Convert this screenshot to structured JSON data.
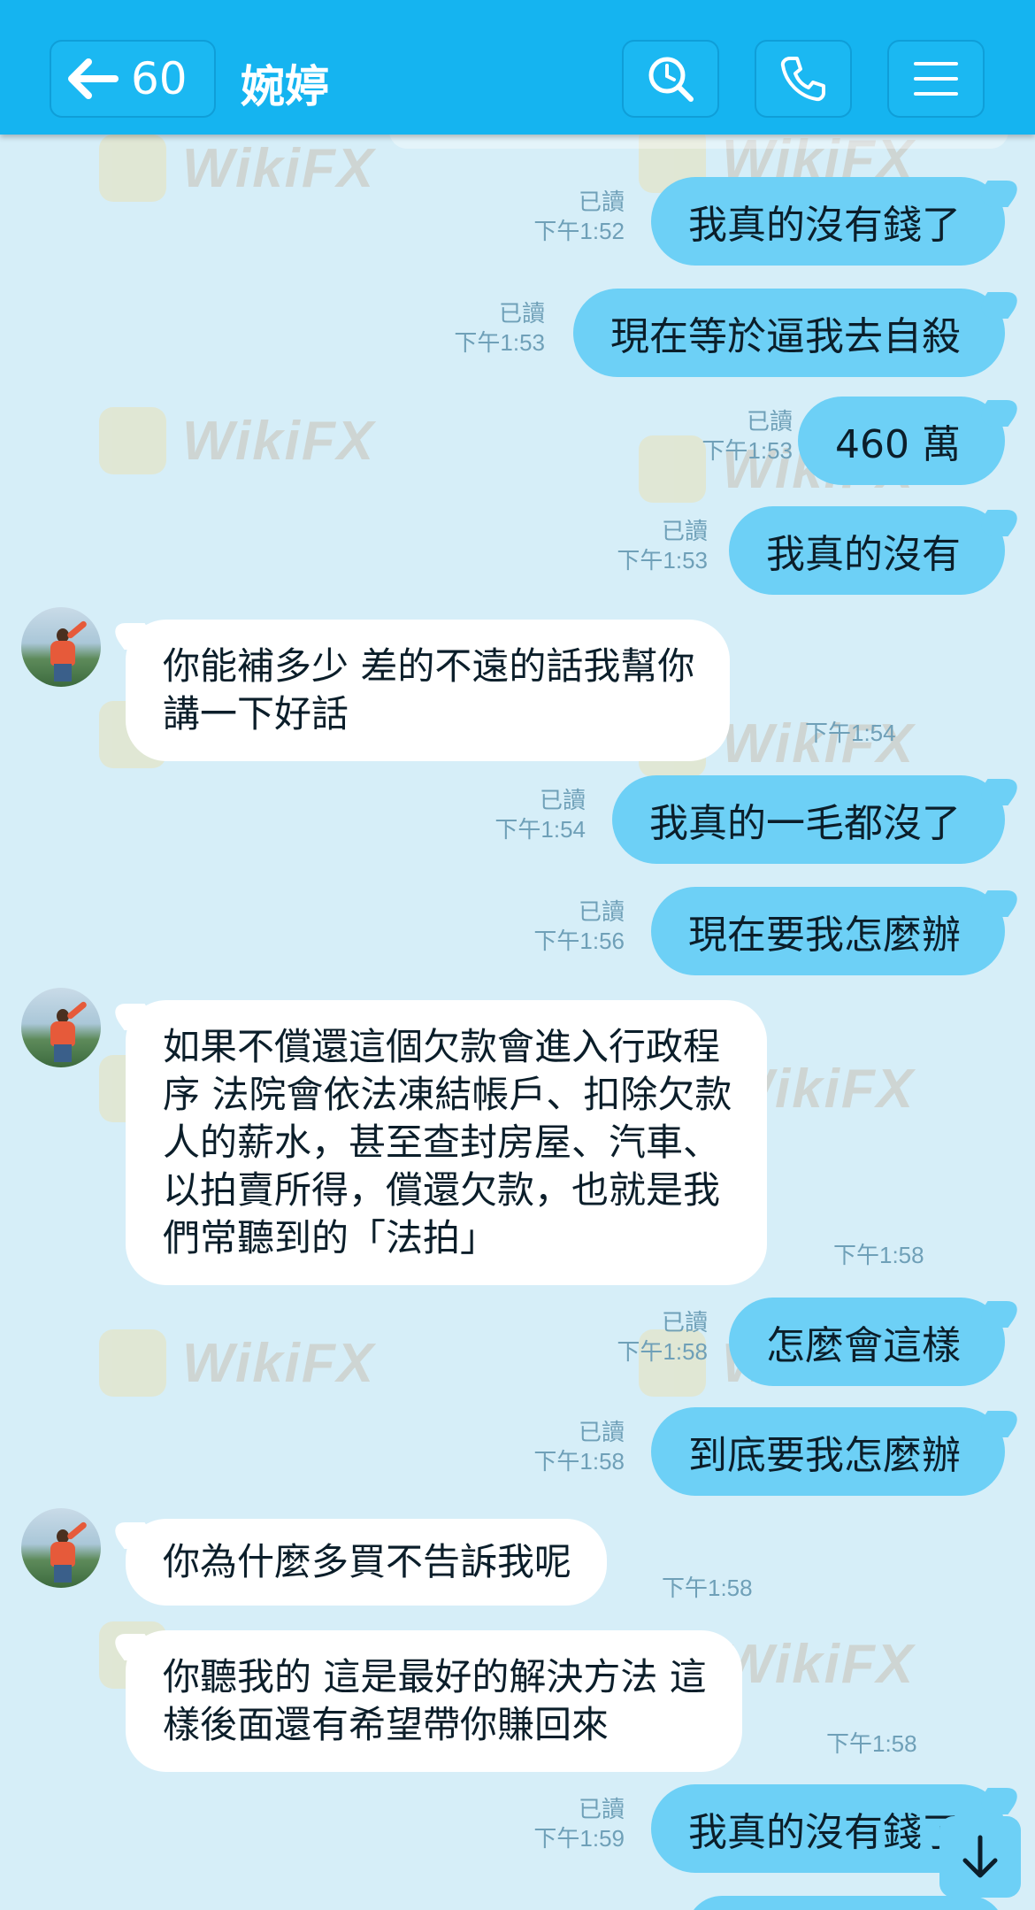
{
  "header": {
    "unread_count": "60",
    "contact_name": "婉婷"
  },
  "watermark": {
    "text": "WikiFX"
  },
  "messages": [
    {
      "dir": "out",
      "text": "我真的沒有錢了",
      "read": "已讀",
      "time": "下午1:52"
    },
    {
      "dir": "out",
      "text": "現在等於逼我去自殺",
      "read": "已讀",
      "time": "下午1:53"
    },
    {
      "dir": "out",
      "text": "460 萬",
      "read": "已讀",
      "time": "下午1:53"
    },
    {
      "dir": "out",
      "text": "我真的沒有",
      "read": "已讀",
      "time": "下午1:53"
    },
    {
      "dir": "in",
      "lines": [
        "你能補多少  差的不遠的話我幫你",
        "講一下好話"
      ],
      "time": "下午1:54"
    },
    {
      "dir": "out",
      "text": "我真的一毛都沒了",
      "read": "已讀",
      "time": "下午1:54"
    },
    {
      "dir": "out",
      "text": "現在要我怎麼辦",
      "read": "已讀",
      "time": "下午1:56"
    },
    {
      "dir": "in",
      "lines": [
        "如果不償還這個欠款會進入行政程",
        "序 法院會依法凍結帳戶、扣除欠款",
        "人的薪水，甚至查封房屋、汽車、",
        "以拍賣所得，償還欠款，也就是我",
        "們常聽到的「法拍」"
      ],
      "time": "下午1:58"
    },
    {
      "dir": "out",
      "text": "怎麼會這樣",
      "read": "已讀",
      "time": "下午1:58"
    },
    {
      "dir": "out",
      "text": "到底要我怎麼辦",
      "read": "已讀",
      "time": "下午1:58"
    },
    {
      "dir": "in",
      "lines": [
        "你為什麼多買不告訴我呢"
      ],
      "time": "下午1:58"
    },
    {
      "dir": "in",
      "lines": [
        "你聽我的  這是最好的解決方法  這",
        "樣後面還有希望帶你賺回來"
      ],
      "time": "下午1:58"
    },
    {
      "dir": "out",
      "text": "我真的沒有錢了",
      "read": "已讀",
      "time": "下午1:59"
    }
  ]
}
